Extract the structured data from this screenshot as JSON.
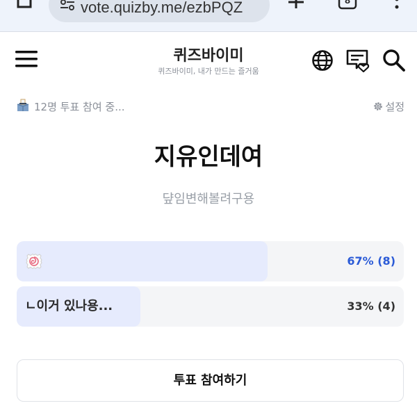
{
  "browser": {
    "url": "vote.quizby.me/ezbPQZ",
    "tab_count": "8",
    "icons": [
      "home-icon",
      "tune-icon",
      "plus-icon",
      "tabs-icon",
      "menu-dots-icon"
    ]
  },
  "header": {
    "title": "퀴즈바이미",
    "subtitle": "퀴즈바이미, 내가 만드는 즐거움",
    "icons": [
      "hamburger-menu-icon",
      "globe-icon",
      "chat-heart-icon",
      "search-icon"
    ]
  },
  "status": {
    "participants": "12명 투표 참여 중...",
    "settings_label": "설정"
  },
  "vote": {
    "title": "지유인데여",
    "description": "댶임변해볼려구용"
  },
  "options": [
    {
      "label": "",
      "icon": "fishcake-icon",
      "result": "67% (8)",
      "percent": 67,
      "votes": 8
    },
    {
      "label": "ㄴ이거 있나용...",
      "result": "33% (4)",
      "percent": 33,
      "votes": 4
    }
  ],
  "vote_button_label": "투표 참여하기",
  "colors": {
    "accent": "#2b5bd7",
    "bar_fill": "#e6ebfd",
    "bar_track": "#f4f5f7",
    "chrome_bg": "#eef3fb"
  }
}
